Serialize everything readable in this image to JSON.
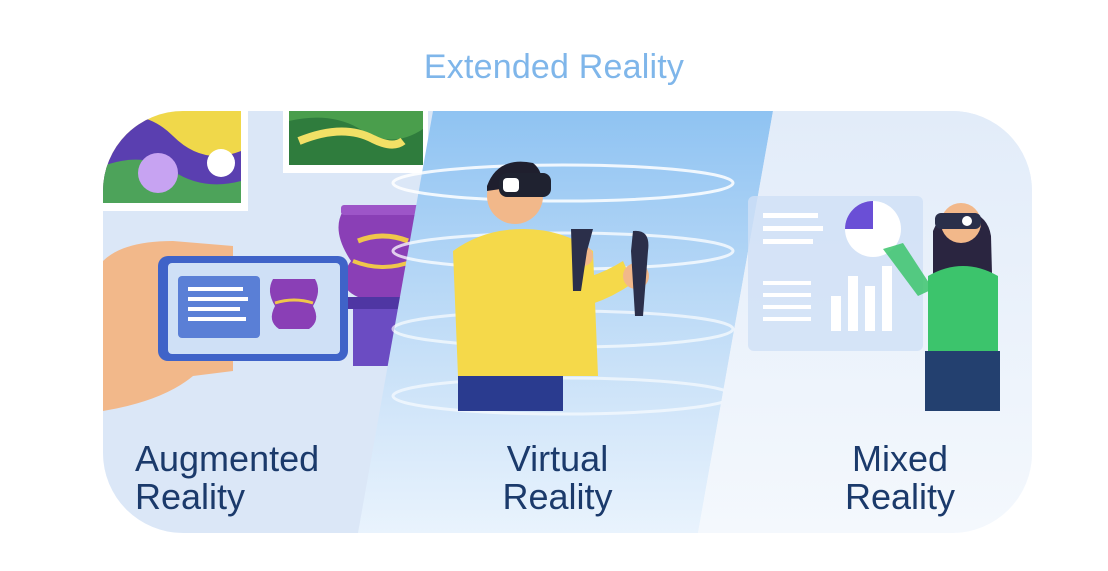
{
  "title": "Extended Reality",
  "panels": [
    {
      "line1": "Augmented",
      "line2": "Reality"
    },
    {
      "line1": "Virtual",
      "line2": "Reality"
    },
    {
      "line1": "Mixed",
      "line2": "Reality"
    }
  ],
  "colors": {
    "title": "#7fb6ea",
    "label": "#1b3a6b",
    "shirt_yellow": "#f5d94a",
    "shirt_green": "#3cc46c",
    "vase_purple": "#8a3fb6",
    "phone_blue": "#3f63c8"
  }
}
